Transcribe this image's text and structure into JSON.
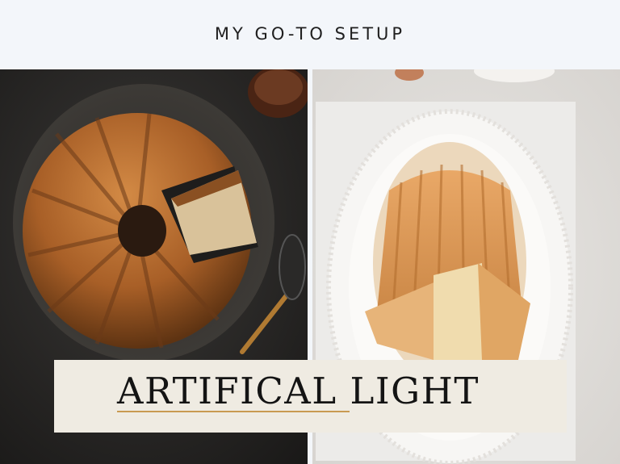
{
  "header": {
    "title": "MY GO-TO SETUP"
  },
  "banner": {
    "title": "ARTIFICAL LIGHT"
  },
  "photos": {
    "left": {
      "subject": "bundt-cake-dark"
    },
    "right": {
      "subject": "bundt-cake-light"
    }
  },
  "colors": {
    "page_background": "#f3f6fa",
    "banner_background": "#efebe2",
    "accent_underline": "#c99a52",
    "text_dark": "#141414"
  }
}
